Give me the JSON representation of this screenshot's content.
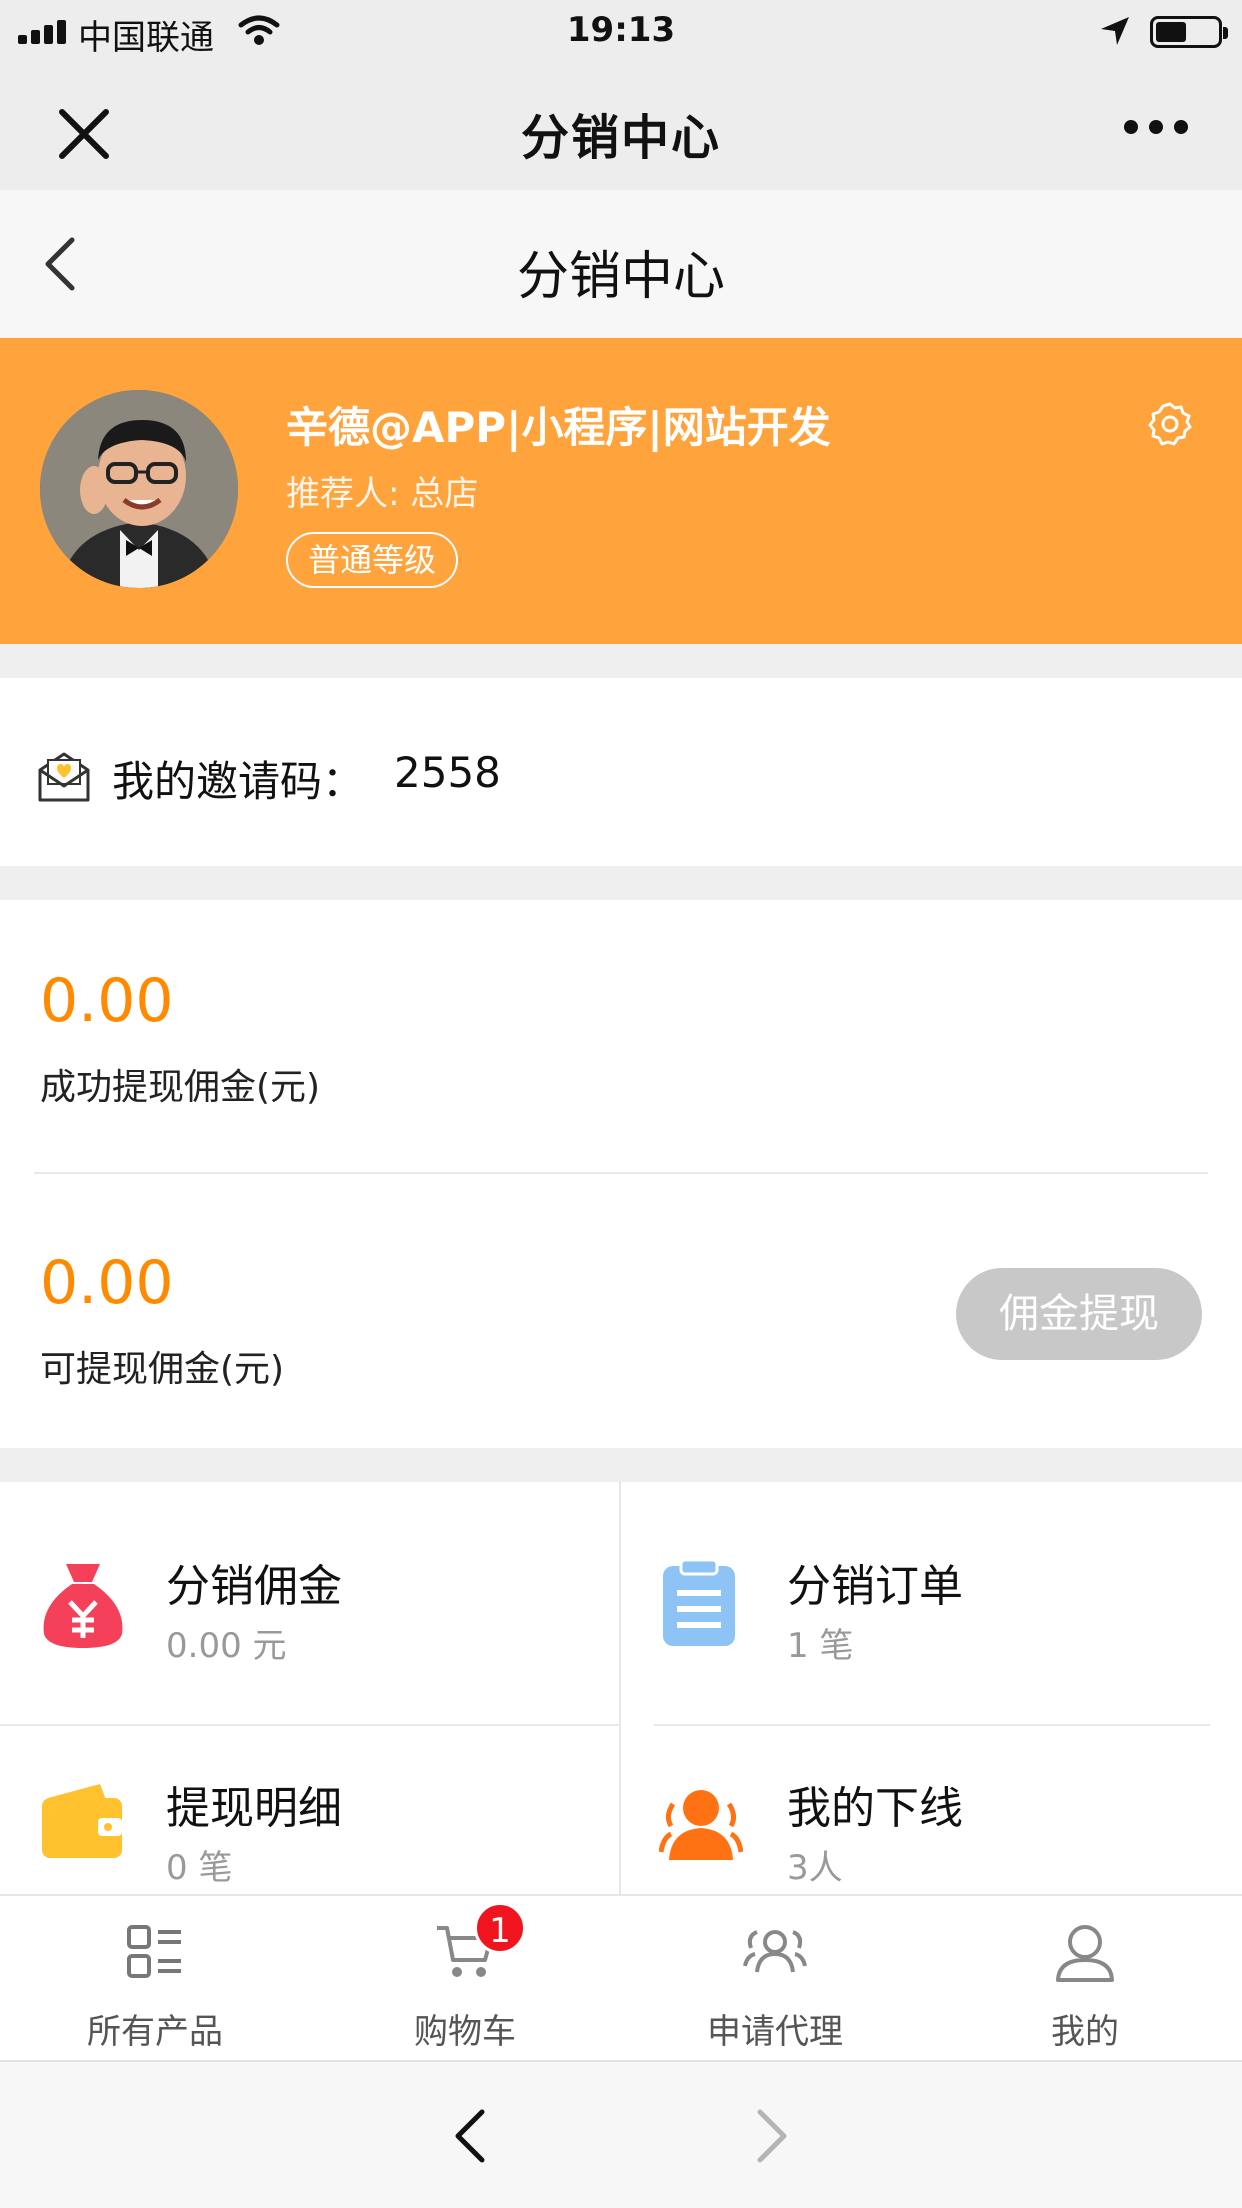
{
  "status_bar": {
    "carrier": "中国联通",
    "time": "19:13"
  },
  "wechat_bar": {
    "title": "分销中心"
  },
  "page_header": {
    "title": "分销中心"
  },
  "profile": {
    "nickname": "辛德@APP|小程序|网站开发",
    "referrer": "推荐人: 总店",
    "level": "普通等级"
  },
  "invite": {
    "label": "我的邀请码：",
    "code": "2558"
  },
  "commission": {
    "withdrawn_amount": "0.00",
    "withdrawn_label": "成功提现佣金(元)",
    "available_amount": "0.00",
    "available_label": "可提现佣金(元)",
    "withdraw_button": "佣金提现"
  },
  "grid": [
    {
      "title": "分销佣金",
      "sub": "0.00 元",
      "icon": "money-bag-icon",
      "color": "#f5405a"
    },
    {
      "title": "分销订单",
      "sub": "1 笔",
      "icon": "clipboard-icon",
      "color": "#8ec4f5"
    },
    {
      "title": "提现明细",
      "sub": "0 笔",
      "icon": "wallet-icon",
      "color": "#ffc22e"
    },
    {
      "title": "我的下线",
      "sub": "3人",
      "icon": "team-icon",
      "color": "#ff7214"
    }
  ],
  "tabbar": {
    "products": "所有产品",
    "cart": "购物车",
    "cart_badge": "1",
    "agent": "申请代理",
    "me": "我的"
  },
  "colors": {
    "accent": "#ffa33c",
    "amount": "#ff8a00",
    "badge": "#f0141e"
  }
}
